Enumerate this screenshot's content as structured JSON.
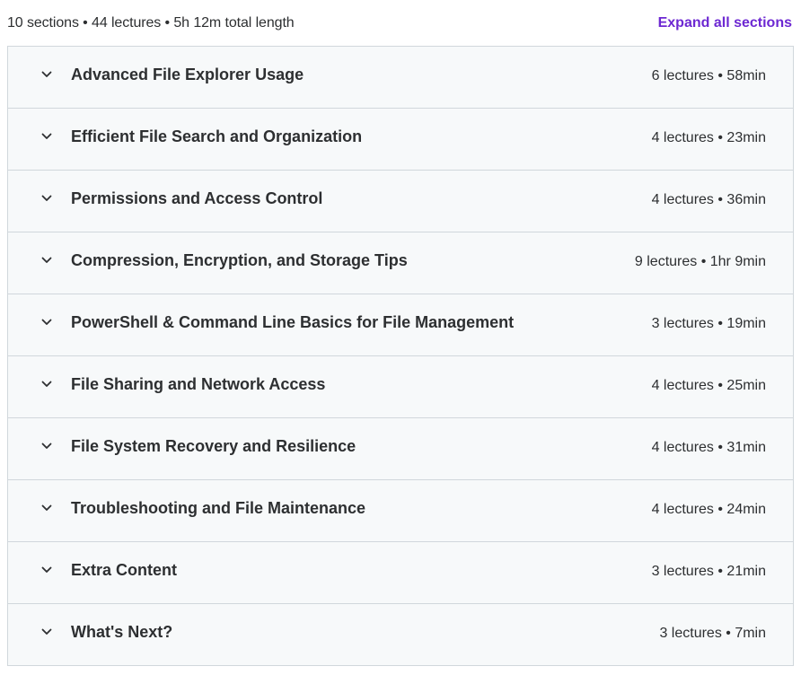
{
  "summary": {
    "text": "10 sections • 44 lectures • 5h 12m total length",
    "expand_label": "Expand all sections"
  },
  "colors": {
    "accent": "#6d28d2",
    "text": "#2d2f31",
    "row_bg": "#f7f9fa",
    "border": "#d1d7dc"
  },
  "sections": [
    {
      "title": "Advanced File Explorer Usage",
      "meta": "6 lectures • 58min",
      "icon": "chevron-down-icon"
    },
    {
      "title": "Efficient File Search and Organization",
      "meta": "4 lectures • 23min",
      "icon": "chevron-down-icon"
    },
    {
      "title": "Permissions and Access Control",
      "meta": "4 lectures • 36min",
      "icon": "chevron-down-icon"
    },
    {
      "title": "Compression, Encryption, and Storage Tips",
      "meta": "9 lectures • 1hr 9min",
      "icon": "chevron-down-icon"
    },
    {
      "title": "PowerShell & Command Line Basics for File Management",
      "meta": "3 lectures • 19min",
      "icon": "chevron-down-icon"
    },
    {
      "title": "File Sharing and Network Access",
      "meta": "4 lectures • 25min",
      "icon": "chevron-down-icon"
    },
    {
      "title": "File System Recovery and Resilience",
      "meta": "4 lectures • 31min",
      "icon": "chevron-down-icon"
    },
    {
      "title": "Troubleshooting and File Maintenance",
      "meta": "4 lectures • 24min",
      "icon": "chevron-down-icon"
    },
    {
      "title": "Extra Content",
      "meta": "3 lectures • 21min",
      "icon": "chevron-down-icon"
    },
    {
      "title": "What's Next?",
      "meta": "3 lectures • 7min",
      "icon": "chevron-down-icon"
    }
  ]
}
